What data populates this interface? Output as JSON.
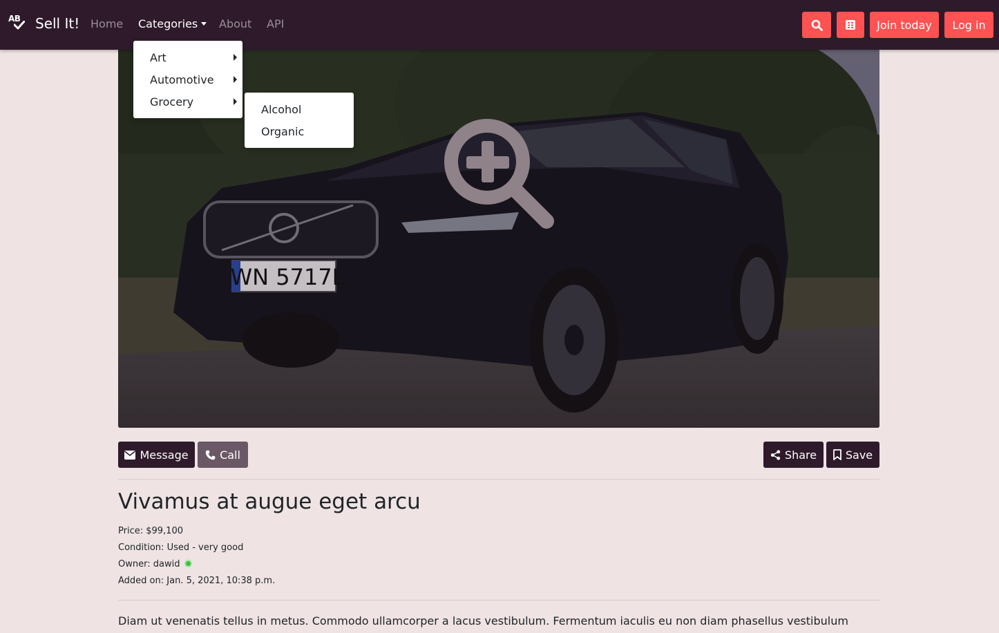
{
  "navbar": {
    "logo_text": "AB",
    "brand": "Sell It!",
    "links": {
      "home": "Home",
      "categories": "Categories",
      "about": "About",
      "api": "API"
    },
    "join_label": "Join today",
    "login_label": "Log in",
    "accent_color": "#fe5253",
    "bg_color": "#2e1a2b"
  },
  "categories_menu": {
    "items": [
      "Art",
      "Automotive",
      "Grocery"
    ],
    "open_submenu": "Grocery",
    "submenu_items": [
      "Alcohol",
      "Organic"
    ]
  },
  "listing": {
    "image_alt": "Black Volvo sedan parked on roadside",
    "plate_text": "WN 5717L",
    "actions": {
      "message": "Message",
      "call": "Call",
      "share": "Share",
      "save": "Save"
    },
    "title": "Vivamus at augue eget arcu",
    "price_label": "Price:",
    "price": "$99,100",
    "condition_label": "Condition:",
    "condition": "Used - very good",
    "owner_label": "Owner:",
    "owner": "dawid",
    "owner_status": "online",
    "added_label": "Added on:",
    "added_on": "Jan. 5, 2021, 10:38 p.m.",
    "description": "Diam ut venenatis tellus in metus. Commodo ullamcorper a lacus vestibulum. Fermentum iaculis eu non diam phasellus vestibulum lorem sed."
  },
  "icons": [
    "search-icon",
    "calculator-icon",
    "envelope-icon",
    "phone-icon",
    "share-icon",
    "bookmark-icon",
    "zoom-in-icon"
  ]
}
